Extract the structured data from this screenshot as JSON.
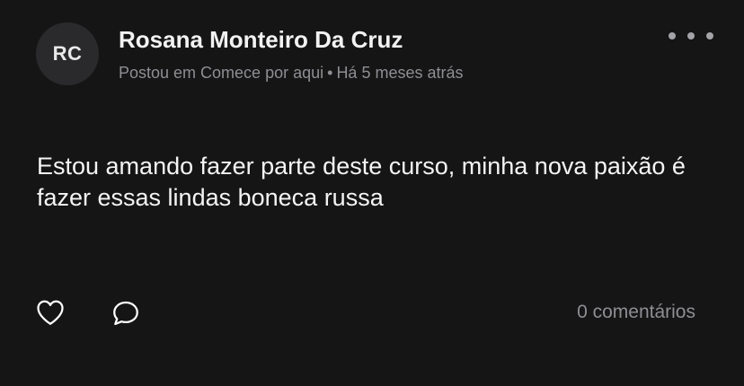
{
  "post": {
    "avatar_initials": "RC",
    "author_name": "Rosana Monteiro Da Cruz",
    "meta_posted_in": "Postou em Comece por aqui",
    "meta_separator": "•",
    "meta_time": "Há 5 meses atrás",
    "body": "Estou amando fazer parte deste curso, minha nova paixão é fazer essas lindas boneca russa",
    "comments_count": "0 comentários"
  },
  "icons": {
    "more": "more-horizontal-icon",
    "like": "heart-outline-icon",
    "comment": "speech-bubble-icon"
  },
  "colors": {
    "background": "#151516",
    "avatar_bg": "#2a2a2c",
    "muted_text": "#8e8e93"
  }
}
